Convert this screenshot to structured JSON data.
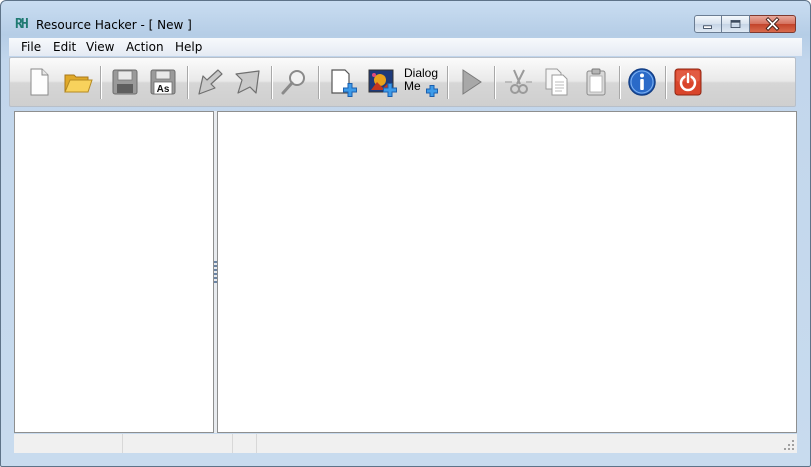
{
  "window": {
    "app_icon_text": "RH",
    "title": "Resource Hacker - [ New ]"
  },
  "menu": [
    {
      "label": "File"
    },
    {
      "label": "Edit"
    },
    {
      "label": "View"
    },
    {
      "label": "Action"
    },
    {
      "label": "Help"
    }
  ],
  "toolbar": {
    "buttons": [
      {
        "name": "new-file-icon",
        "tooltip": ""
      },
      {
        "name": "open-folder-icon",
        "tooltip": ""
      },
      {
        "name": "save-icon",
        "tooltip": ""
      },
      {
        "name": "save-as-icon",
        "label": "As"
      },
      {
        "name": "compile-icon"
      },
      {
        "name": "run-arrow-icon"
      },
      {
        "name": "find-icon"
      },
      {
        "name": "add-resource-icon"
      },
      {
        "name": "add-image-icon"
      },
      {
        "name": "dialog-menu-icon"
      },
      {
        "name": "play-icon"
      },
      {
        "name": "cut-icon"
      },
      {
        "name": "copy-icon"
      },
      {
        "name": "paste-icon"
      },
      {
        "name": "info-icon"
      },
      {
        "name": "exit-icon"
      }
    ],
    "dialog_menu_line1": "Dialog",
    "dialog_menu_line2": "Me"
  },
  "status": {
    "cells": [
      "",
      "",
      "",
      ""
    ]
  },
  "colors": {
    "accent_blue": "#2a6ac8",
    "exit_red": "#d9452b",
    "add_blue": "#2e7fd6"
  }
}
